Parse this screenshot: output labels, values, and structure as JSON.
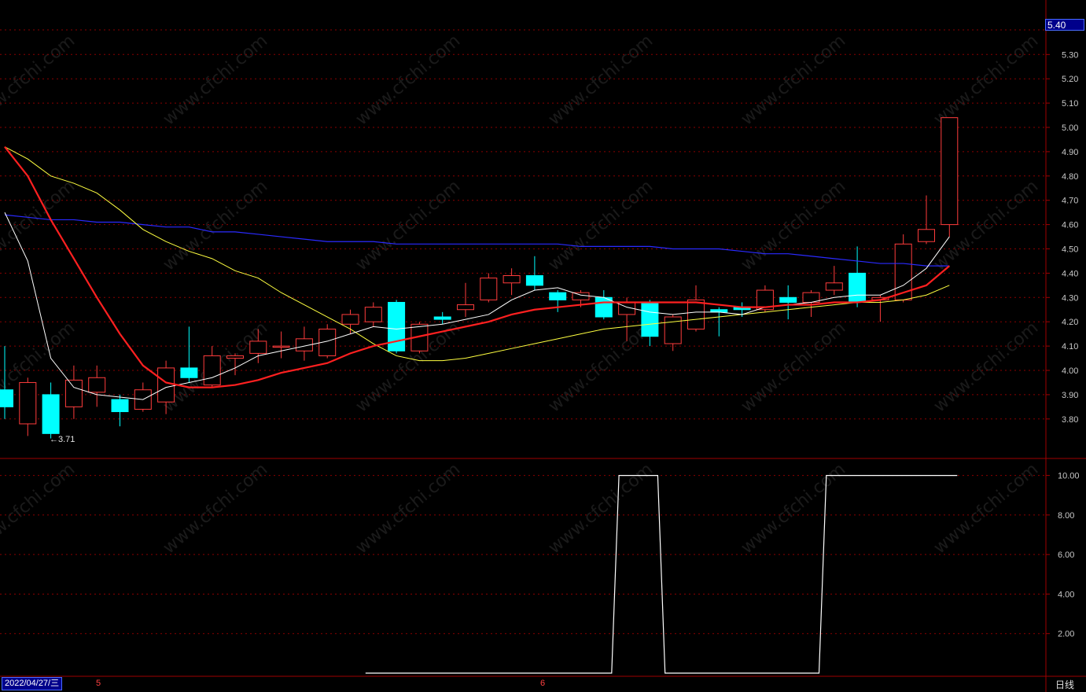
{
  "price_badge": "5.40",
  "date_label": "2022/04/27/三",
  "month_labels": [
    "5",
    "6"
  ],
  "period_label": "日线",
  "low_marker": "←3.71",
  "watermark": "www.cfchi.com",
  "colors": {
    "background": "#000000",
    "grid": "#8b0000",
    "axis": "#a00000",
    "up": "#ff3c3c",
    "down": "#00ffff",
    "ma5": "#ffffff",
    "ma10": "#ff2020",
    "ma20": "#ffff40",
    "ma60": "#2a2aff",
    "indicator": "#ffffff"
  },
  "chart_data": [
    {
      "type": "candlestick",
      "title": "",
      "ylim": [
        3.7,
        5.44
      ],
      "y_ticks": [
        "5.30",
        "5.20",
        "5.10",
        "5.00",
        "4.90",
        "4.80",
        "4.70",
        "4.60",
        "4.50",
        "4.40",
        "4.30",
        "4.20",
        "4.10",
        "4.00",
        "3.90",
        "3.80"
      ],
      "candles": [
        {
          "o": 3.92,
          "h": 4.1,
          "l": 3.8,
          "c": 3.85
        },
        {
          "o": 3.78,
          "h": 3.97,
          "l": 3.73,
          "c": 3.95
        },
        {
          "o": 3.9,
          "h": 3.95,
          "l": 3.72,
          "c": 3.74
        },
        {
          "o": 3.85,
          "h": 4.02,
          "l": 3.8,
          "c": 3.96
        },
        {
          "o": 3.91,
          "h": 4.02,
          "l": 3.85,
          "c": 3.97
        },
        {
          "o": 3.88,
          "h": 3.9,
          "l": 3.77,
          "c": 3.83
        },
        {
          "o": 3.84,
          "h": 3.95,
          "l": 3.83,
          "c": 3.92
        },
        {
          "o": 3.87,
          "h": 4.04,
          "l": 3.82,
          "c": 4.01
        },
        {
          "o": 4.01,
          "h": 4.18,
          "l": 3.95,
          "c": 3.97
        },
        {
          "o": 3.94,
          "h": 4.1,
          "l": 3.93,
          "c": 4.06
        },
        {
          "o": 4.05,
          "h": 4.07,
          "l": 3.98,
          "c": 4.06
        },
        {
          "o": 4.07,
          "h": 4.17,
          "l": 4.03,
          "c": 4.12
        },
        {
          "o": 4.1,
          "h": 4.16,
          "l": 4.05,
          "c": 4.1
        },
        {
          "o": 4.08,
          "h": 4.18,
          "l": 4.04,
          "c": 4.13
        },
        {
          "o": 4.06,
          "h": 4.19,
          "l": 4.05,
          "c": 4.17
        },
        {
          "o": 4.19,
          "h": 4.25,
          "l": 4.15,
          "c": 4.23
        },
        {
          "o": 4.2,
          "h": 4.28,
          "l": 4.18,
          "c": 4.26
        },
        {
          "o": 4.28,
          "h": 4.29,
          "l": 4.07,
          "c": 4.08
        },
        {
          "o": 4.08,
          "h": 4.2,
          "l": 4.07,
          "c": 4.19
        },
        {
          "o": 4.22,
          "h": 4.24,
          "l": 4.19,
          "c": 4.21
        },
        {
          "o": 4.25,
          "h": 4.36,
          "l": 4.22,
          "c": 4.27
        },
        {
          "o": 4.29,
          "h": 4.4,
          "l": 4.28,
          "c": 4.38
        },
        {
          "o": 4.36,
          "h": 4.42,
          "l": 4.31,
          "c": 4.39
        },
        {
          "o": 4.39,
          "h": 4.47,
          "l": 4.33,
          "c": 4.35
        },
        {
          "o": 4.32,
          "h": 4.33,
          "l": 4.24,
          "c": 4.29
        },
        {
          "o": 4.29,
          "h": 4.33,
          "l": 4.26,
          "c": 4.32
        },
        {
          "o": 4.3,
          "h": 4.33,
          "l": 4.21,
          "c": 4.22
        },
        {
          "o": 4.23,
          "h": 4.3,
          "l": 4.12,
          "c": 4.28
        },
        {
          "o": 4.28,
          "h": 4.29,
          "l": 4.1,
          "c": 4.14
        },
        {
          "o": 4.11,
          "h": 4.23,
          "l": 4.08,
          "c": 4.22
        },
        {
          "o": 4.17,
          "h": 4.35,
          "l": 4.16,
          "c": 4.29
        },
        {
          "o": 4.25,
          "h": 4.26,
          "l": 4.14,
          "c": 4.24
        },
        {
          "o": 4.26,
          "h": 4.28,
          "l": 4.22,
          "c": 4.25
        },
        {
          "o": 4.25,
          "h": 4.35,
          "l": 4.24,
          "c": 4.33
        },
        {
          "o": 4.3,
          "h": 4.35,
          "l": 4.21,
          "c": 4.28
        },
        {
          "o": 4.28,
          "h": 4.33,
          "l": 4.22,
          "c": 4.32
        },
        {
          "o": 4.33,
          "h": 4.43,
          "l": 4.31,
          "c": 4.36
        },
        {
          "o": 4.4,
          "h": 4.51,
          "l": 4.26,
          "c": 4.28
        },
        {
          "o": 4.29,
          "h": 4.31,
          "l": 4.2,
          "c": 4.3
        },
        {
          "o": 4.29,
          "h": 4.56,
          "l": 4.28,
          "c": 4.52
        },
        {
          "o": 4.53,
          "h": 4.72,
          "l": 4.52,
          "c": 4.58
        },
        {
          "o": 4.6,
          "h": 5.04,
          "l": 4.55,
          "c": 5.04
        }
      ],
      "ma5": [
        4.65,
        4.45,
        4.05,
        3.93,
        3.9,
        3.89,
        3.88,
        3.93,
        3.95,
        3.97,
        4.01,
        4.06,
        4.08,
        4.1,
        4.12,
        4.15,
        4.18,
        4.17,
        4.18,
        4.19,
        4.21,
        4.23,
        4.29,
        4.33,
        4.34,
        4.31,
        4.3,
        4.26,
        4.24,
        4.23,
        4.24,
        4.24,
        4.23,
        4.26,
        4.27,
        4.28,
        4.3,
        4.31,
        4.31,
        4.35,
        4.42,
        4.55
      ],
      "ma10": [
        4.92,
        4.8,
        4.62,
        4.46,
        4.3,
        4.15,
        4.02,
        3.95,
        3.93,
        3.93,
        3.94,
        3.96,
        3.99,
        4.01,
        4.03,
        4.07,
        4.1,
        4.12,
        4.14,
        4.16,
        4.18,
        4.2,
        4.23,
        4.25,
        4.26,
        4.27,
        4.28,
        4.28,
        4.28,
        4.28,
        4.28,
        4.27,
        4.26,
        4.26,
        4.27,
        4.27,
        4.28,
        4.28,
        4.29,
        4.32,
        4.35,
        4.43
      ],
      "ma20": [
        4.92,
        4.87,
        4.8,
        4.77,
        4.73,
        4.66,
        4.58,
        4.53,
        4.49,
        4.46,
        4.41,
        4.38,
        4.32,
        4.27,
        4.22,
        4.17,
        4.11,
        4.06,
        4.04,
        4.04,
        4.05,
        4.07,
        4.09,
        4.11,
        4.13,
        4.15,
        4.17,
        4.18,
        4.19,
        4.2,
        4.21,
        4.22,
        4.23,
        4.24,
        4.25,
        4.26,
        4.27,
        4.28,
        4.28,
        4.29,
        4.31,
        4.35
      ],
      "ma60": [
        4.64,
        4.63,
        4.62,
        4.62,
        4.61,
        4.61,
        4.6,
        4.59,
        4.59,
        4.57,
        4.57,
        4.56,
        4.55,
        4.54,
        4.53,
        4.53,
        4.53,
        4.52,
        4.52,
        4.52,
        4.52,
        4.52,
        4.52,
        4.52,
        4.52,
        4.51,
        4.51,
        4.51,
        4.51,
        4.5,
        4.5,
        4.5,
        4.49,
        4.48,
        4.48,
        4.47,
        4.46,
        4.45,
        4.44,
        4.44,
        4.43,
        4.43
      ]
    },
    {
      "type": "line",
      "title": "",
      "ylim": [
        0,
        11
      ],
      "y_ticks": [
        "10.00",
        "8.00",
        "6.00",
        "4.00",
        "2.00"
      ],
      "start_index": 16,
      "values": [
        0,
        0,
        0,
        0,
        0,
        0,
        0,
        0,
        0,
        0,
        0,
        10,
        10,
        0,
        0,
        0,
        0,
        0,
        0,
        0,
        10,
        10,
        10,
        10,
        10,
        10
      ]
    }
  ]
}
